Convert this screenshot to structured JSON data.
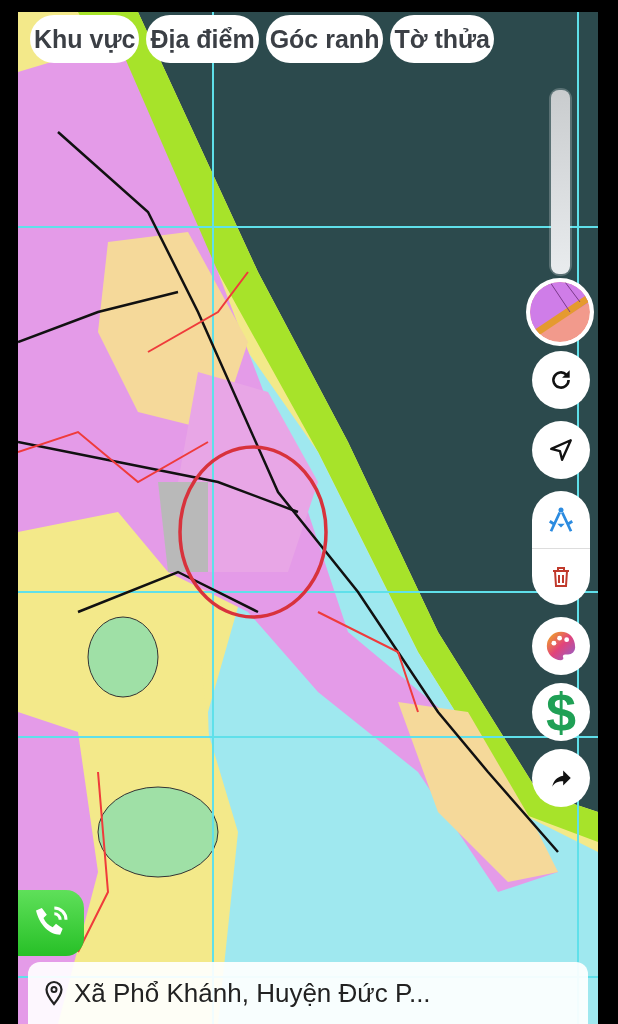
{
  "tabs": [
    {
      "label": "Khu vực"
    },
    {
      "label": "Địa điểm"
    },
    {
      "label": "Góc ranh"
    },
    {
      "label": "Tờ thửa"
    }
  ],
  "opacity_slider": {
    "level": 1
  },
  "tools": [
    {
      "kind": "refresh"
    },
    {
      "kind": "locate"
    },
    {
      "kind": "group",
      "items": [
        {
          "kind": "measure"
        },
        {
          "kind": "delete"
        }
      ]
    },
    {
      "kind": "palette"
    },
    {
      "kind": "price",
      "glyph": "$"
    },
    {
      "kind": "share"
    }
  ],
  "address": {
    "text": "Xã Phổ Khánh, Huyện Đức P..."
  }
}
